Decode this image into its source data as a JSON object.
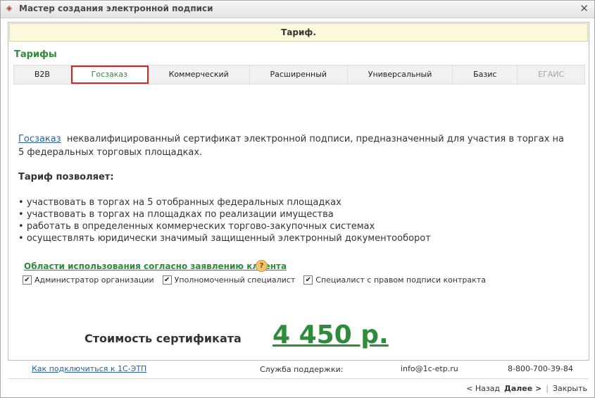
{
  "window": {
    "title": "Мастер создания электронной подписи"
  },
  "banner": {
    "text": "Тариф."
  },
  "tariffs": {
    "title": "Тарифы",
    "tabs": [
      {
        "label": "B2B"
      },
      {
        "label": "Госзаказ"
      },
      {
        "label": "Коммерческий"
      },
      {
        "label": "Расширенный"
      },
      {
        "label": "Универсальный"
      },
      {
        "label": "Базис"
      },
      {
        "label": "ЕГАИС"
      }
    ],
    "selected": "Госзаказ"
  },
  "description": {
    "link": "Госзаказ",
    "text": "неквалифицированный сертификат электронной подписи, предназначенный для участия в торгах на 5 федеральных торговых площадках."
  },
  "allows": {
    "title": "Тариф позволяет:",
    "items": [
      "участвовать в торгах на 5 отобранных федеральных площадках",
      "участвовать в торгах на площадках по реализации имущества",
      "работать в определенных коммерческих торгово-закупочных системах",
      "осуществлять юридически значимый защищенный электронный документооборот"
    ]
  },
  "areas": {
    "title": "Области использования согласно заявлению клиента",
    "help": "?",
    "options": [
      {
        "label": "Администратор организации",
        "checked": true
      },
      {
        "label": "Уполномоченный специалист",
        "checked": true
      },
      {
        "label": "Специалист с правом подписи контракта",
        "checked": true
      }
    ]
  },
  "cost": {
    "label": "Стоимость сертификата",
    "value": "4 450 р."
  },
  "footer": {
    "connect_link": "Как подключиться к 1С-ЭТП",
    "support_label": "Служба поддержки:",
    "email": "info@1c-etp.ru",
    "phone": "8-800-700-39-84"
  },
  "nav": {
    "back": "< Назад",
    "next": "Далее >",
    "close": "Закрыть"
  },
  "colors": {
    "accent_green": "#2e8b3a",
    "link_blue": "#2b5fa7",
    "selected_outline": "#e02020",
    "banner_bg": "#fbf8dc"
  }
}
